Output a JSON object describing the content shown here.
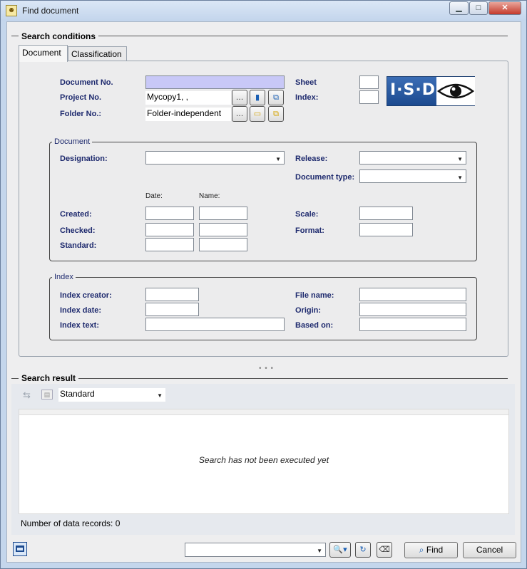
{
  "window": {
    "title": "Find document",
    "minimize": "▁",
    "maximize": "□",
    "close": "✕"
  },
  "search_conditions": {
    "title": "Search conditions",
    "tabs": [
      {
        "label": "Document",
        "active": true
      },
      {
        "label": "Classification",
        "active": false
      }
    ],
    "top": {
      "document_no_label": "Document No.",
      "document_no_value": "",
      "project_no_label": "Project No.",
      "project_no_value": "Mycopy1, ,",
      "folder_no_label": "Folder No.:",
      "folder_no_value": "Folder-independent",
      "sheet_label": "Sheet",
      "sheet_value": "",
      "index_label": "Index:",
      "index_value": "",
      "logo_text": "I·S·D"
    },
    "document_group": {
      "legend": "Document",
      "designation_label": "Designation:",
      "designation_value": "",
      "release_label": "Release:",
      "release_value": "",
      "document_type_label": "Document type:",
      "document_type_value": "",
      "date_header": "Date:",
      "name_header": "Name:",
      "created_label": "Created:",
      "checked_label": "Checked:",
      "standard_label": "Standard:",
      "scale_label": "Scale:",
      "format_label": "Format:"
    },
    "index_group": {
      "legend": "Index",
      "index_creator_label": "Index creator:",
      "index_date_label": "Index date:",
      "index_text_label": "Index text:",
      "file_name_label": "File name:",
      "origin_label": "Origin:",
      "based_on_label": "Based on:"
    }
  },
  "search_result": {
    "title": "Search result",
    "view_select_value": "Standard",
    "empty_message": "Search has not been executed yet",
    "records_text": "Number of data records: 0"
  },
  "footer": {
    "preset_value": "",
    "find_label": "Find",
    "cancel_label": "Cancel"
  },
  "colors": {
    "highlight_input": "#c8c8f7",
    "label_blue": "#1e2a6e",
    "logo_blue": "#2a5aa0"
  }
}
